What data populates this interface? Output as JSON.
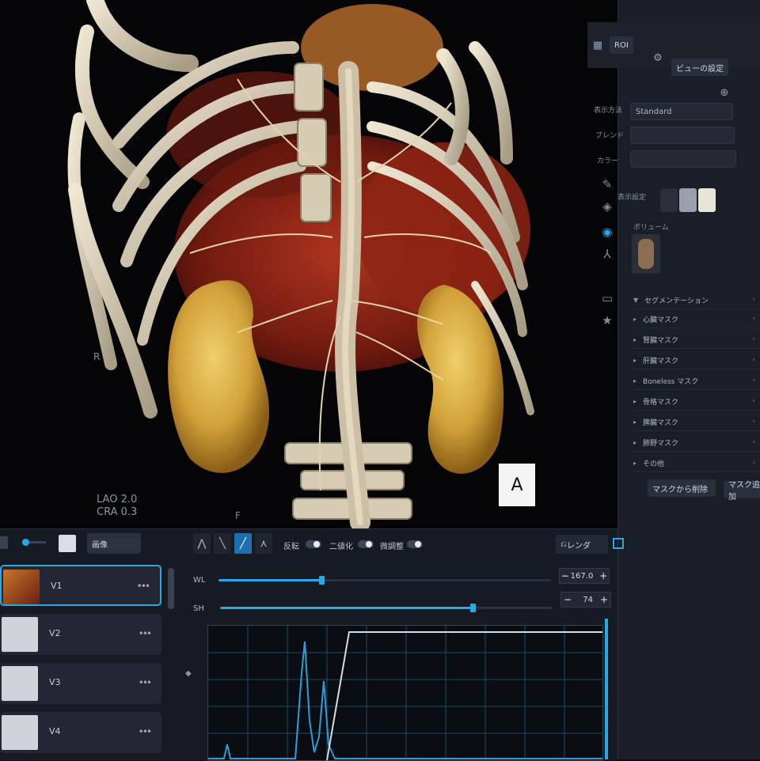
{
  "viewport": {
    "orientation_right": "R",
    "orientation_foot": "F",
    "angle_readout": "LAO 2.0\nCRA 0.3",
    "view_label": "A"
  },
  "right_panel": {
    "header_btn_1": "ROI",
    "header_btn_2": "ビューの設定",
    "field_1_label": "表示方法",
    "field_1_value": "Standard",
    "field_2_label": "ブレンド",
    "field_3_label": "カラー",
    "preset_label": "表示設定",
    "section_title": "ボリューム",
    "list_title": "セグメンテーション",
    "items": [
      {
        "label": "心臓マスク"
      },
      {
        "label": "腎臓マスク"
      },
      {
        "label": "肝臓マスク"
      },
      {
        "label": "Boneless マスク"
      },
      {
        "label": "骨格マスク"
      },
      {
        "label": "脾臓マスク"
      },
      {
        "label": "肺野マスク"
      },
      {
        "label": "その他"
      }
    ],
    "footer_btn_1": "マスクから削除",
    "footer_btn_2": "マスク追加"
  },
  "bottom_panel": {
    "toolbar_btn": "画像",
    "render_btn": "レンダ",
    "toggles": [
      {
        "label": "反転"
      },
      {
        "label": "二値化"
      },
      {
        "label": "微調整"
      }
    ],
    "sliders": [
      {
        "label": "WL",
        "value": "167.0",
        "fraction": 0.31
      },
      {
        "label": "SH",
        "value": "74",
        "fraction": 0.76
      }
    ],
    "volumes": [
      {
        "label": "V1",
        "selected": true
      },
      {
        "label": "V2",
        "selected": false
      },
      {
        "label": "V3",
        "selected": false
      },
      {
        "label": "V4",
        "selected": false
      }
    ]
  },
  "colors": {
    "accent": "#28a8e6",
    "bone": "#d9cfb8",
    "vessel_red": "#a3281a",
    "kidney": "#d7a73a"
  },
  "icons": [
    "grid-icon",
    "zoom-icon",
    "settings-icon",
    "pen-icon",
    "paint-icon",
    "person-icon",
    "layers-icon",
    "star-icon",
    "render-icon"
  ]
}
